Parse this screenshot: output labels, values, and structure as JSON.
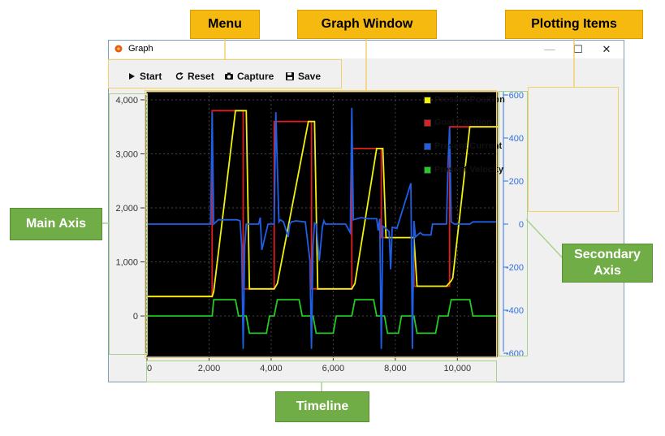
{
  "window": {
    "title": "Graph",
    "minimize": "—",
    "maximize": "☐",
    "close": "✕"
  },
  "toolbar": {
    "start": "Start",
    "reset": "Reset",
    "capture": "Capture",
    "save": "Save"
  },
  "legend": [
    {
      "label": "Present Position",
      "color": "#f2f20a"
    },
    {
      "label": "Goal Position",
      "color": "#e02020"
    },
    {
      "label": "Present Current",
      "color": "#1f5fe6"
    },
    {
      "label": "Present Velocity",
      "color": "#22cc22"
    }
  ],
  "callouts": {
    "menu": "Menu",
    "graph_window": "Graph Window",
    "plotting_items": "Plotting Items",
    "main_axis": "Main Axis",
    "secondary_axis": "Secondary Axis",
    "timeline": "Timeline"
  },
  "chart_data": {
    "type": "line",
    "title": "",
    "xlabel": "",
    "ylabel": "",
    "xlim": [
      0,
      11300
    ],
    "ylim": [
      -750,
      4150
    ],
    "y2lim": [
      -615,
      615
    ],
    "grid": true,
    "x_ticks": [
      "0",
      "2,000",
      "4,000",
      "6,000",
      "8,000",
      "10,000"
    ],
    "x_tick_values": [
      0,
      2000,
      4000,
      6000,
      8000,
      10000
    ],
    "y_ticks": [
      "0",
      "1,000",
      "2,000",
      "3,000",
      "4,000"
    ],
    "y_tick_values": [
      0,
      1000,
      2000,
      3000,
      4000
    ],
    "y2_ticks": [
      "-600",
      "-400",
      "-200",
      "0",
      "200",
      "400",
      "600"
    ],
    "y2_tick_values": [
      -600,
      -400,
      -200,
      0,
      200,
      400,
      600
    ],
    "series": [
      {
        "name": "Goal Position",
        "color": "#e02020",
        "axis": "left",
        "x": [
          0,
          2100,
          2100,
          3100,
          3100,
          4100,
          4100,
          5300,
          5300,
          6600,
          6600,
          7550,
          7550,
          8600,
          8600,
          9750,
          9750,
          11300
        ],
        "y": [
          360,
          360,
          3800,
          3800,
          500,
          500,
          3600,
          3600,
          500,
          500,
          3100,
          3100,
          1450,
          1450,
          550,
          550,
          3500,
          3500
        ]
      },
      {
        "name": "Present Position",
        "color": "#f2f20a",
        "axis": "left",
        "x": [
          0,
          2100,
          2150,
          2850,
          3200,
          3300,
          4100,
          4200,
          5200,
          5400,
          5500,
          6600,
          6700,
          7400,
          7600,
          7700,
          8600,
          8700,
          9650,
          9800,
          9850,
          10400,
          11300
        ],
        "y": [
          360,
          360,
          450,
          3800,
          3800,
          500,
          500,
          600,
          3600,
          3600,
          500,
          500,
          600,
          3100,
          3100,
          1450,
          1450,
          550,
          550,
          650,
          700,
          3500,
          3500
        ]
      },
      {
        "name": "Present Velocity",
        "color": "#22cc22",
        "axis": "left",
        "x": [
          0,
          2100,
          2150,
          2850,
          2950,
          3050,
          3200,
          3300,
          3850,
          3950,
          4100,
          4200,
          4900,
          5000,
          5100,
          5350,
          5450,
          6000,
          6100,
          6600,
          6700,
          7300,
          7400,
          7500,
          7650,
          7750,
          8100,
          8200,
          8600,
          8700,
          9300,
          9400,
          9700,
          9800,
          10400,
          10500,
          11300
        ],
        "y": [
          0,
          0,
          300,
          300,
          0,
          0,
          0,
          -320,
          -320,
          0,
          0,
          300,
          300,
          0,
          0,
          0,
          -320,
          -320,
          0,
          0,
          300,
          300,
          0,
          0,
          0,
          -320,
          -320,
          0,
          0,
          -320,
          -320,
          0,
          0,
          300,
          300,
          0,
          0
        ]
      },
      {
        "name": "Present Current",
        "color": "#1f5fe6",
        "axis": "right",
        "x": [
          0,
          2050,
          2100,
          2150,
          2300,
          2900,
          3000,
          3050,
          3100,
          3150,
          3200,
          3300,
          3400,
          3600,
          3650,
          3700,
          3900,
          4100,
          4150,
          4250,
          4300,
          4400,
          4550,
          4600,
          4650,
          4800,
          5100,
          5250,
          5300,
          5350,
          5400,
          5450,
          5550,
          5650,
          5700,
          5750,
          5950,
          6400,
          6550,
          6600,
          6650,
          6900,
          7100,
          7400,
          7450,
          7500,
          7550,
          7600,
          7700,
          7800,
          7850,
          7900,
          8050,
          8500,
          8550,
          8600,
          8650,
          8800,
          8900,
          9150,
          9200,
          9650,
          9700,
          9750,
          9800,
          9900,
          10400,
          10500,
          11300
        ],
        "y": [
          0,
          0,
          520,
          0,
          20,
          20,
          15,
          -100,
          -580,
          -100,
          0,
          0,
          0,
          0,
          30,
          -120,
          0,
          0,
          520,
          10,
          20,
          10,
          -60,
          0,
          10,
          15,
          10,
          -170,
          -580,
          -100,
          5,
          0,
          -170,
          -15,
          15,
          0,
          0,
          0,
          -40,
          540,
          20,
          30,
          25,
          25,
          -30,
          25,
          -580,
          -10,
          -20,
          -35,
          -210,
          -15,
          -20,
          190,
          -580,
          15,
          -60,
          -40,
          -50,
          -50,
          0,
          0,
          280,
          450,
          10,
          0,
          0,
          10,
          10
        ]
      }
    ]
  }
}
